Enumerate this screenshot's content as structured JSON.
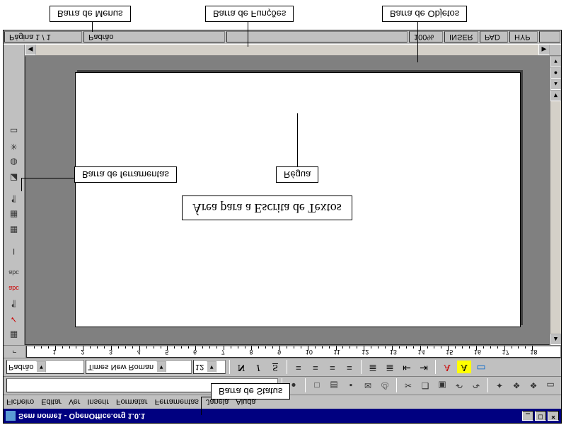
{
  "title": "Sem nome1 - OpenOffice.org 1.0.1",
  "menus": [
    "Ficheiro",
    "Editar",
    "Ver",
    "Inserir",
    "Formatar",
    "Ferramentas",
    "Janela",
    "Ajuda"
  ],
  "format_toolbar": {
    "style": "Padrão",
    "font": "Times New Roman",
    "size": "12",
    "bold": "N",
    "italic": "I",
    "underline": "S"
  },
  "ruler": {
    "min": 1,
    "max": 18
  },
  "document_text": "Área  para a Escrita de Textos",
  "status": {
    "page": "Página 1 / 1",
    "template": "Padrão",
    "zoom": "100%",
    "insert": "INSER",
    "pad": "PAD",
    "hyp": "HYP"
  },
  "callouts": {
    "menus": "Barra de Menus",
    "functions": "Barra de Funções",
    "objects": "Barra de Objetos",
    "tools": "Barra de ferramentas",
    "ruler": "Régua",
    "status": "Barra de Status"
  },
  "window_controls": {
    "min": "_",
    "max": "□",
    "close": "×"
  },
  "icons": {
    "circle": "●",
    "new": "□",
    "open": "▤",
    "save": "▪",
    "mail": "✉",
    "print": "⎙",
    "cut": "✂",
    "copy": "❐",
    "paste": "▣",
    "undo": "↶",
    "redo": "↷",
    "nav": "✦",
    "worm": "❖",
    "help": "▭",
    "align_l": "≡",
    "align_c": "≡",
    "align_r": "≡",
    "align_j": "≡",
    "list_n": "≣",
    "list_b": "≣",
    "indent_l": "⇤",
    "indent_r": "⇥",
    "color_a": "A",
    "hilite": "A",
    "bg": "▭",
    "side1": "▦",
    "side_sp": "✓",
    "side_br": "¶",
    "side_abc": "abc",
    "side_abc2": "abc",
    "side_t": "I",
    "side_tbl": "▦",
    "side_tbl2": "▦",
    "side_p": "¶",
    "side_sq": "◪",
    "side_g": "◍",
    "side_s": "✳",
    "side_r": "▭"
  }
}
